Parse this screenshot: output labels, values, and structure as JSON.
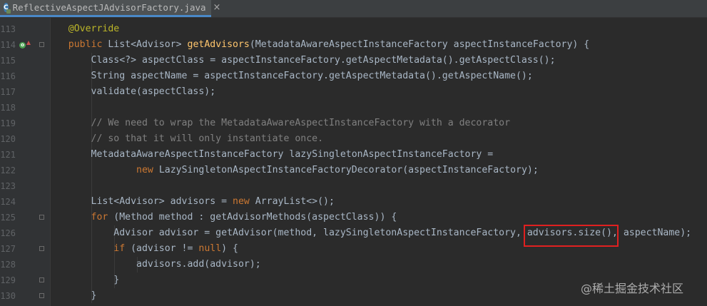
{
  "tab": {
    "title": "ReflectiveAspectJAdvisorFactory.java",
    "close": "×",
    "icon": "C"
  },
  "lines": [
    {
      "num": "113",
      "segments": [
        {
          "t": "    @Override",
          "c": "ann"
        }
      ]
    },
    {
      "num": "114",
      "segments": [
        {
          "t": "    public ",
          "c": "kw"
        },
        {
          "t": "List<Advisor> ",
          "c": ""
        },
        {
          "t": "getAdvisors",
          "c": "fn"
        },
        {
          "t": "(MetadataAwareAspectInstanceFactory aspectInstanceFactory) {",
          "c": ""
        }
      ]
    },
    {
      "num": "115",
      "segments": [
        {
          "t": "        Class<?> aspectClass = aspectInstanceFactory.getAspectMetadata().getAspectClass();",
          "c": ""
        }
      ]
    },
    {
      "num": "116",
      "segments": [
        {
          "t": "        String aspectName = aspectInstanceFactory.getAspectMetadata().getAspectName();",
          "c": ""
        }
      ]
    },
    {
      "num": "117",
      "segments": [
        {
          "t": "        validate(aspectClass);",
          "c": ""
        }
      ]
    },
    {
      "num": "118",
      "segments": []
    },
    {
      "num": "119",
      "segments": [
        {
          "t": "        // We need to wrap the MetadataAwareAspectInstanceFactory with a decorator",
          "c": "cm"
        }
      ]
    },
    {
      "num": "120",
      "segments": [
        {
          "t": "        // so that it will only instantiate once.",
          "c": "cm"
        }
      ]
    },
    {
      "num": "121",
      "segments": [
        {
          "t": "        MetadataAwareAspectInstanceFactory lazySingletonAspectInstanceFactory =",
          "c": ""
        }
      ]
    },
    {
      "num": "122",
      "segments": [
        {
          "t": "                ",
          "c": ""
        },
        {
          "t": "new ",
          "c": "kw"
        },
        {
          "t": "LazySingletonAspectInstanceFactoryDecorator(aspectInstanceFactory);",
          "c": ""
        }
      ]
    },
    {
      "num": "123",
      "segments": []
    },
    {
      "num": "124",
      "segments": [
        {
          "t": "        List<Advisor> advisors = ",
          "c": ""
        },
        {
          "t": "new ",
          "c": "kw"
        },
        {
          "t": "ArrayList<>();",
          "c": ""
        }
      ]
    },
    {
      "num": "125",
      "segments": [
        {
          "t": "        for ",
          "c": "kw"
        },
        {
          "t": "(Method method : getAdvisorMethods(aspectClass)) {",
          "c": ""
        }
      ]
    },
    {
      "num": "126",
      "segments": [
        {
          "t": "            Advisor advisor = getAdvisor(method, lazySingletonAspectInstanceFactory, advisors.size(), aspectName);",
          "c": ""
        }
      ]
    },
    {
      "num": "127",
      "segments": [
        {
          "t": "            if ",
          "c": "kw"
        },
        {
          "t": "(advisor != ",
          "c": ""
        },
        {
          "t": "null",
          "c": "kw"
        },
        {
          "t": ") {",
          "c": ""
        }
      ]
    },
    {
      "num": "128",
      "segments": [
        {
          "t": "                advisors.add(advisor);",
          "c": ""
        }
      ]
    },
    {
      "num": "129",
      "segments": [
        {
          "t": "            }",
          "c": ""
        }
      ]
    },
    {
      "num": "130",
      "segments": [
        {
          "t": "        }",
          "c": ""
        }
      ]
    }
  ],
  "watermark": "@稀土掘金技术社区",
  "colors": {
    "background": "#2b2b2b",
    "keyword": "#cc7832",
    "annotation": "#bbb529",
    "function": "#ffc66d",
    "comment": "#808080",
    "text": "#a9b7c6",
    "highlight": "#e02020"
  }
}
